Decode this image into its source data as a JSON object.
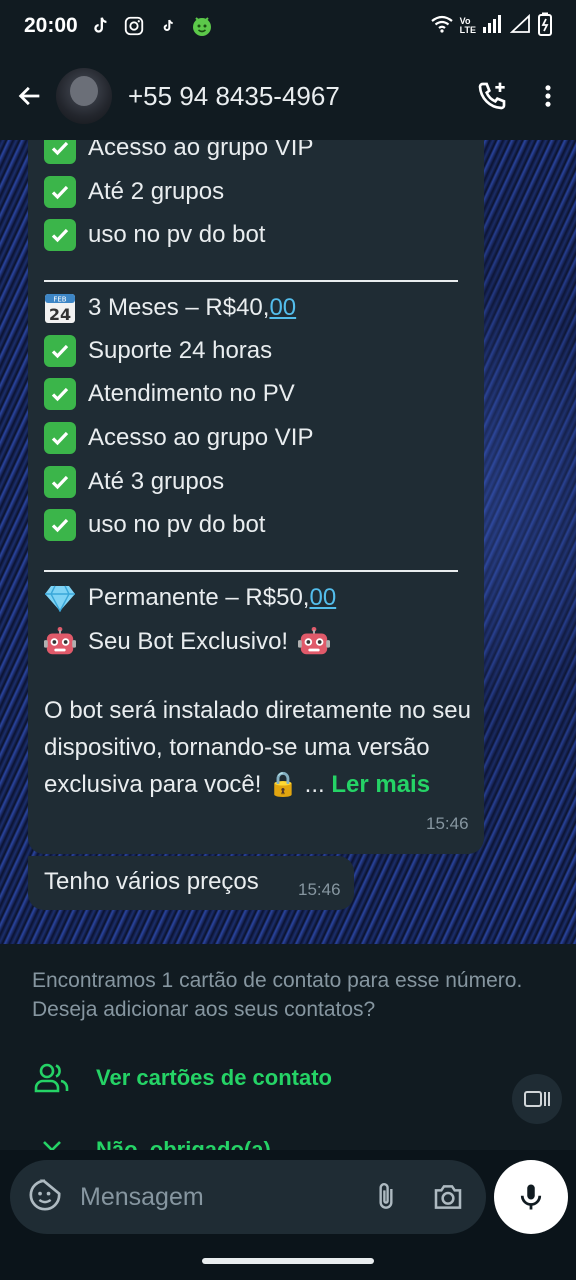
{
  "status_bar": {
    "time": "20:00",
    "volte_top": "Vo",
    "volte_bottom": "LTE"
  },
  "header": {
    "contact_name": "+55 94 8435-4967",
    "icons": [
      "back-arrow-icon",
      "add-call-icon",
      "more-vert-icon"
    ]
  },
  "message_main": {
    "items": [
      {
        "type": "check",
        "text": "Acesso ao grupo VIP"
      },
      {
        "type": "check",
        "text": "Até 2 grupos"
      },
      {
        "type": "check",
        "text": "uso no pv do bot"
      },
      {
        "type": "calendar",
        "text": "3 Meses – R$40,",
        "link": "00",
        "cal_month": "FEB",
        "cal_day": "24"
      },
      {
        "type": "check",
        "text": "Suporte 24 horas"
      },
      {
        "type": "check",
        "text": "Atendimento no PV"
      },
      {
        "type": "check",
        "text": "Acesso ao grupo VIP"
      },
      {
        "type": "check",
        "text": "Até 3 grupos"
      },
      {
        "type": "check",
        "text": "uso no pv do bot"
      },
      {
        "type": "diamond",
        "text": "Permanente – R$50,",
        "link": "00"
      },
      {
        "type": "robot",
        "text": "Seu Bot Exclusivo!"
      }
    ],
    "paragraph": "O bot será instalado diretamente no seu dispositivo, tornando-se uma versão exclusiva para você! 🔒 ...",
    "read_more": "Ler mais",
    "time": "15:46"
  },
  "message_small": {
    "text": "Tenho vários preços",
    "time": "15:46"
  },
  "contact_panel": {
    "info": "Encontramos 1 cartão de contato para esse número. Deseja adicionar aos seus contatos?",
    "view_cards": "Ver cartões de contato",
    "no_thanks": "Não, obrigado(a)"
  },
  "input": {
    "placeholder": "Mensagem"
  },
  "colors": {
    "accent": "#25d366",
    "link": "#53bdeb",
    "bubble": "#1f2c34",
    "background": "#0b141a"
  }
}
